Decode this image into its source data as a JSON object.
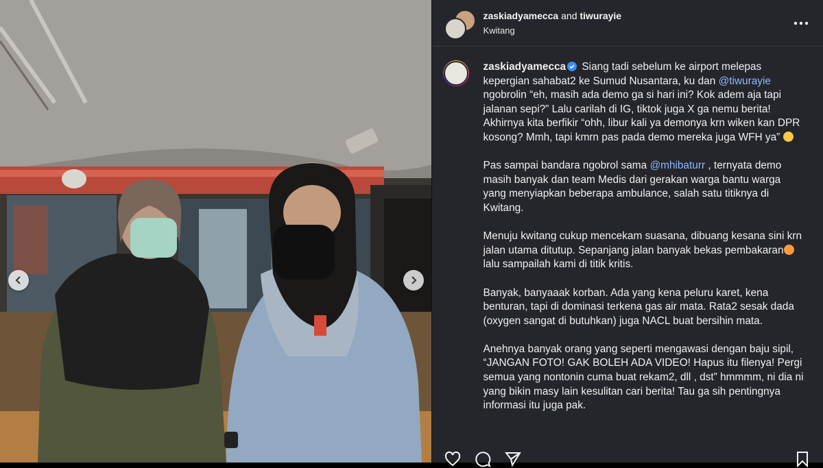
{
  "header": {
    "user1": "zaskiadyamecca",
    "and_text": "and",
    "user2": "tiwurayie",
    "location": "Kwitang"
  },
  "caption": {
    "username": "zaskiadyamecca",
    "p1_a": "Siang tadi sebelum ke airport melepas kepergian sahabat2 ke Sumud Nusantara, ku dan",
    "p1_mention": "@tiwurayie",
    "p1_b": "ngobrolin “eh, masih ada demo ga si hari ini? Kok adem aja tapi jalanan sepi?” Lalu carilah di IG, tiktok juga X ga nemu berita! Akhirnya kita berfikir “ohh, libur kali ya demonya krn wiken kan DPR kosong? Mmh, tapi kmrn pas pada demo mereka juga WFH ya”",
    "p2_a": "Pas sampai bandara ngobrol sama",
    "p2_mention": "@mhibaturr",
    "p2_b": ", ternyata demo masih banyak dan team Medis dari gerakan warga bantu warga yang menyiapkan beberapa ambulance, salah satu titiknya di Kwitang.",
    "p3_a": "Menuju kwitang cukup mencekam suasana, dibuang kesana sini krn jalan utama ditutup. Sepanjang jalan banyak bekas pembakaran",
    "p3_b": "lalu sampailah kami di titik kritis.",
    "p4": "Banyak, banyaaak korban. Ada yang kena peluru karet, kena benturan, tapi di dominasi terkena gas air mata. Rata2 sesak dada (oxygen sangat di butuhkan) juga NACL buat bersihin mata.",
    "p5": "Anehnya banyak orang yang seperti mengawasi dengan baju sipil, “JANGAN FOTO! GAK BOLEH ADA VIDEO! Hapus itu filenya! Pergi semua yang nontonin cuma buat rekam2, dll , dst” hmmmm, ni dia ni yang bikin masy lain kesulitan cari berita! Tau ga sih pentingnya informasi itu juga pak."
  },
  "icons": {
    "verified": "verified-badge-icon",
    "more": "more-options-icon",
    "prev": "chevron-left-icon",
    "next": "chevron-right-icon",
    "like": "heart-icon",
    "comment": "comment-icon",
    "share": "send-icon",
    "save": "bookmark-icon"
  },
  "colors": {
    "panel_bg": "#25262b",
    "mention": "#8fb8ff",
    "verified": "#3b8cf5"
  }
}
